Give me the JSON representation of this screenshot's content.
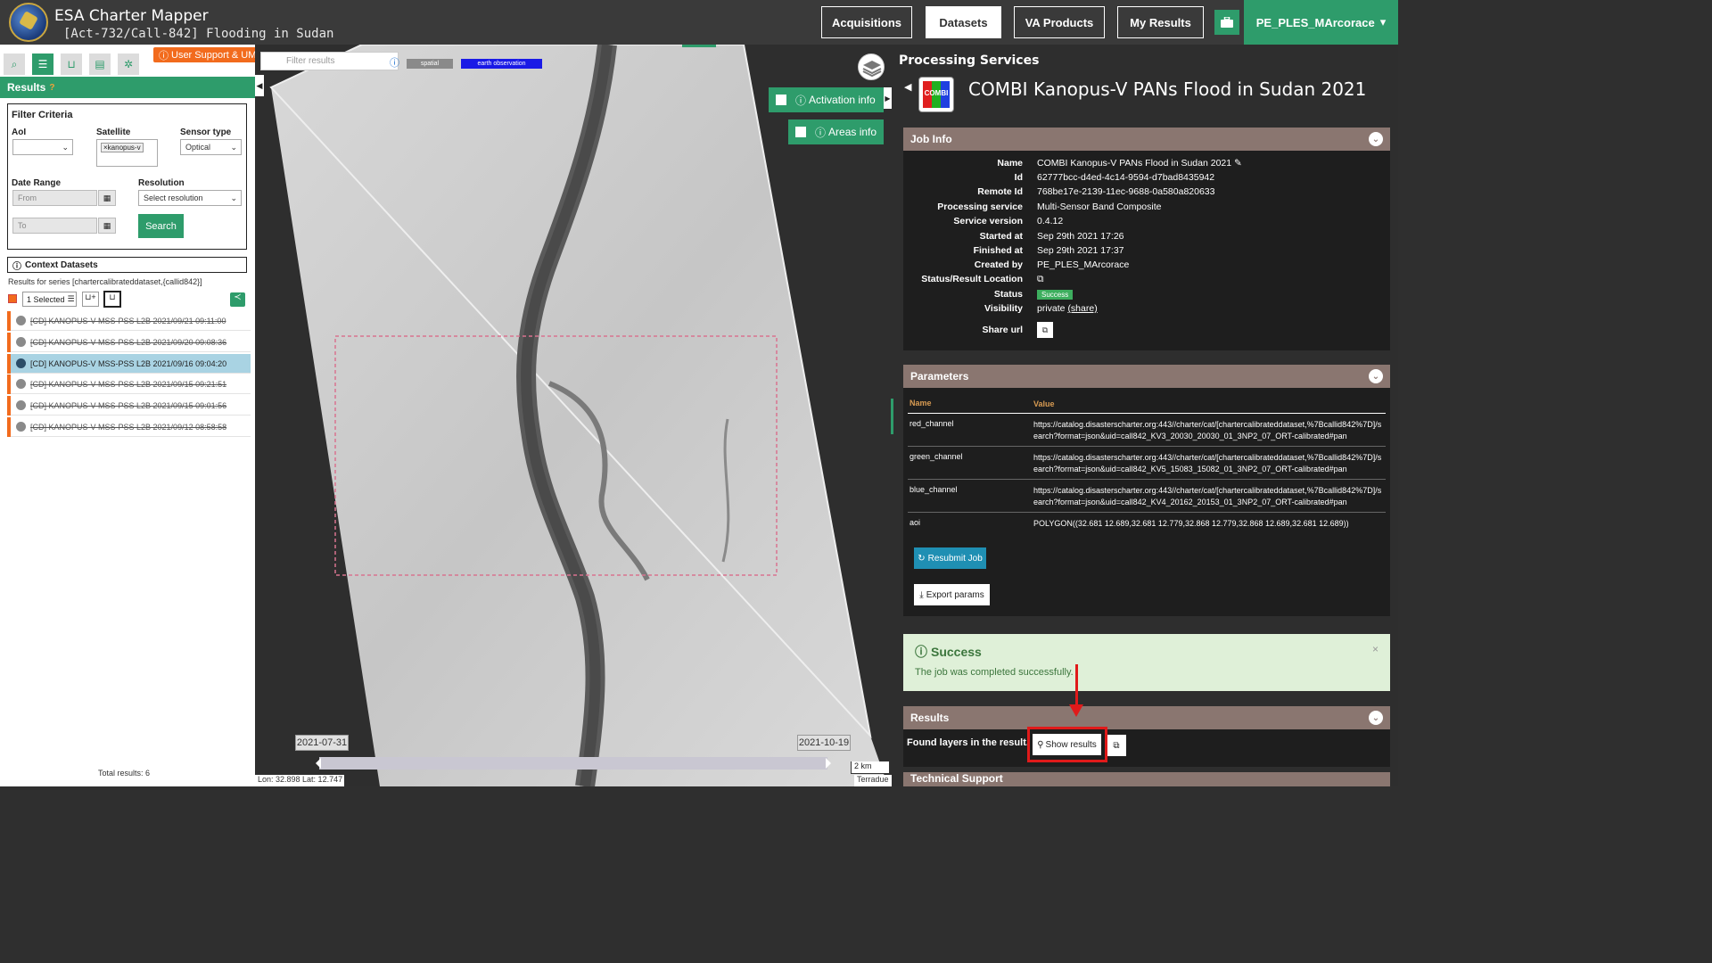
{
  "header": {
    "app_title": "ESA Charter Mapper",
    "app_subtitle": "[Act-732/Call-842] Flooding in Sudan",
    "nav": [
      "Acquisitions",
      "Datasets",
      "VA Products",
      "My Results"
    ],
    "active_nav": "Datasets",
    "user": "PE_PLES_MArcorace",
    "user_caret": "▾"
  },
  "left_panel": {
    "support_label": "User Support & UM",
    "results_label": "Results",
    "filter": {
      "title": "Filter Criteria",
      "aoi_label": "AoI",
      "satellite_label": "Satellite",
      "satellite_value": "×kanopus-v",
      "sensor_label": "Sensor type",
      "sensor_value": "Optical",
      "date_label": "Date Range",
      "from_placeholder": "From",
      "to_placeholder": "To",
      "resolution_label": "Resolution",
      "resolution_value": "Select resolution",
      "search_label": "Search"
    },
    "context_title": "Context Datasets",
    "series_text": "Results for series [chartercalibrateddataset,{callid842}]",
    "selected_label": "1 Selected",
    "datasets": [
      "[CD] KANOPUS-V MSS-PSS L2B 2021/09/21 09:11:00",
      "[CD] KANOPUS-V MSS-PSS L2B 2021/09/20 09:08:36",
      "[CD] KANOPUS-V MSS-PSS L2B 2021/09/16 09:04:20",
      "[CD] KANOPUS-V MSS-PSS L2B 2021/09/15 09:21:51",
      "[CD] KANOPUS-V MSS-PSS L2B 2021/09/15 09:01:56",
      "[CD] KANOPUS-V MSS-PSS L2B 2021/09/12 08:58:58"
    ],
    "selected_index": 2,
    "total": "Total results: 6"
  },
  "map": {
    "filter_placeholder": "Filter results",
    "tags": [
      "spatial",
      "earth observation"
    ],
    "tag_colors": [
      "#8a8a8a",
      "#1a1ae6"
    ],
    "activation_info": "Activation info",
    "areas_info": "Areas info",
    "timeline_start": "2021-07-31",
    "timeline_end": "2021-10-19",
    "scale": "2 km",
    "coords": "Lon: 32.898 Lat: 12.747",
    "attribution": "Terradue"
  },
  "processing": {
    "section_title": "Processing Services",
    "service_title": "COMBI Kanopus-V PANs Flood in Sudan 2021",
    "icon_text": "COMBI",
    "job_info_title": "Job Info",
    "job_info": [
      {
        "k": "Name",
        "v": "COMBI Kanopus-V PANs Flood in Sudan 2021 ✎"
      },
      {
        "k": "Id",
        "v": "62777bcc-d4ed-4c14-9594-d7bad8435942"
      },
      {
        "k": "Remote Id",
        "v": "768be17e-2139-11ec-9688-0a580a820633"
      },
      {
        "k": "Processing service",
        "v": "Multi-Sensor Band Composite"
      },
      {
        "k": "Service version",
        "v": "0.4.12"
      },
      {
        "k": "Started at",
        "v": "Sep 29th 2021 17:26"
      },
      {
        "k": "Finished at",
        "v": "Sep 29th 2021 17:37"
      },
      {
        "k": "Created by",
        "v": "PE_PLES_MArcorace"
      },
      {
        "k": "Status/Result Location",
        "v": "⧉"
      }
    ],
    "status_label": "Status",
    "status_value": "Success",
    "visibility_label": "Visibility",
    "visibility_value": "private",
    "visibility_share": "(share)",
    "share_url_label": "Share url",
    "parameters_title": "Parameters",
    "param_headers": [
      "Name",
      "Value"
    ],
    "parameters": [
      {
        "name": "red_channel",
        "value": "https://catalog.disasterscharter.org:443//charter/cat/[chartercalibrateddataset,%7Bcallid842%7D]/search?format=json&uid=call842_KV3_20030_20030_01_3NP2_07_ORT-calibrated#pan"
      },
      {
        "name": "green_channel",
        "value": "https://catalog.disasterscharter.org:443//charter/cat/[chartercalibrateddataset,%7Bcallid842%7D]/search?format=json&uid=call842_KV5_15083_15082_01_3NP2_07_ORT-calibrated#pan"
      },
      {
        "name": "blue_channel",
        "value": "https://catalog.disasterscharter.org:443//charter/cat/[chartercalibrateddataset,%7Bcallid842%7D]/search?format=json&uid=call842_KV4_20162_20153_01_3NP2_07_ORT-calibrated#pan"
      },
      {
        "name": "aoi",
        "value": "POLYGON((32.681 12.689,32.681 12.779,32.868 12.779,32.868 12.689,32.681 12.689))"
      }
    ],
    "resubmit_label": "Resubmit Job",
    "export_label": "Export params",
    "success_title": "Success",
    "success_msg": "The job was completed successfully.",
    "results_title": "Results",
    "found_layers": "Found layers in the result.",
    "show_results": "Show results",
    "technical_support": "Technical Support"
  },
  "colors": {
    "accent": "#2e9c6b",
    "orange": "#f26b1d",
    "panel_head": "#8a7670",
    "highlight": "#e01a1a"
  }
}
